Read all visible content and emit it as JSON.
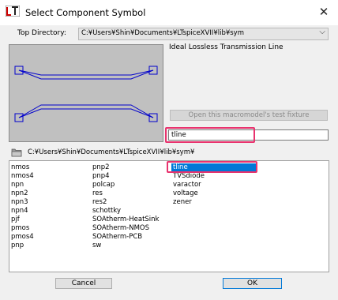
{
  "window": {
    "title": "Select Component Symbol",
    "close_glyph": "✕",
    "icon": "ltspice-app-icon"
  },
  "top_directory": {
    "label": "Top Directory:",
    "value": "C:¥Users¥Shin¥Documents¥LTspiceXVII¥lib¥sym",
    "arrow": "⌵"
  },
  "preview": {
    "description": "Ideal Lossless Transmission Line",
    "line_color": "#0000cc",
    "bg_color": "#c0c0c0"
  },
  "macromodel_button": {
    "label": "Open this macromodel's test fixture",
    "enabled": false
  },
  "name_field": {
    "value": "tline"
  },
  "current_path": "C:¥Users¥Shin¥Documents¥LTspiceXVII¥lib¥sym¥",
  "symbol_list": {
    "columns": [
      [
        "nmos",
        "nmos4",
        "npn",
        "npn2",
        "npn3",
        "npn4",
        "pjf",
        "pmos",
        "pmos4",
        "pnp"
      ],
      [
        "pnp2",
        "pnp4",
        "polcap",
        "res",
        "res2",
        "schottky",
        "SOAtherm-HeatSink",
        "SOAtherm-NMOS",
        "SOAtherm-PCB",
        "sw"
      ],
      [
        "tline",
        "TVSdiode",
        "varactor",
        "voltage",
        "zener"
      ]
    ],
    "selected": "tline"
  },
  "buttons": {
    "cancel": "Cancel",
    "ok": "OK"
  },
  "highlight_color": "#e8336e",
  "selection_color": "#0078d7"
}
